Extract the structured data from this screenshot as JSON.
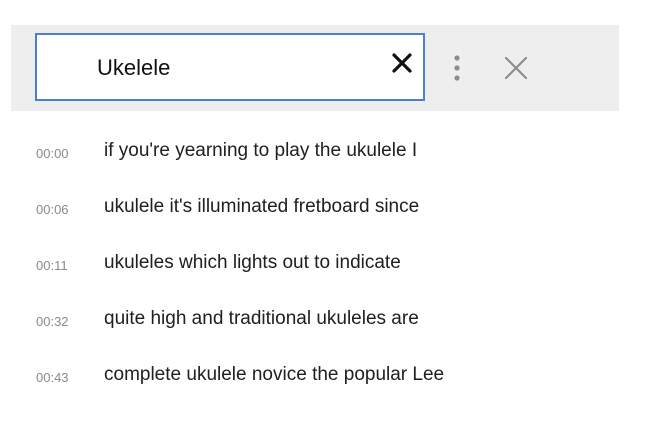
{
  "search": {
    "value": "Ukelele",
    "clear_icon": "close-x-icon"
  },
  "toolbar": {
    "more_icon": "more-vertical-icon",
    "close_icon": "close-icon"
  },
  "colors": {
    "search_border": "#4a7fd4",
    "bar_background": "#eeeeee",
    "timestamp_text": "#8a8a8a",
    "caption_text": "#202020"
  },
  "results": [
    {
      "time": "00:00",
      "text": "if you're yearning to play the ukulele I"
    },
    {
      "time": "00:06",
      "text": "ukulele it's illuminated fretboard since"
    },
    {
      "time": "00:11",
      "text": "ukuleles which lights out to indicate"
    },
    {
      "time": "00:32",
      "text": "quite high and traditional ukuleles are"
    },
    {
      "time": "00:43",
      "text": "complete ukulele novice the popular Lee"
    }
  ]
}
